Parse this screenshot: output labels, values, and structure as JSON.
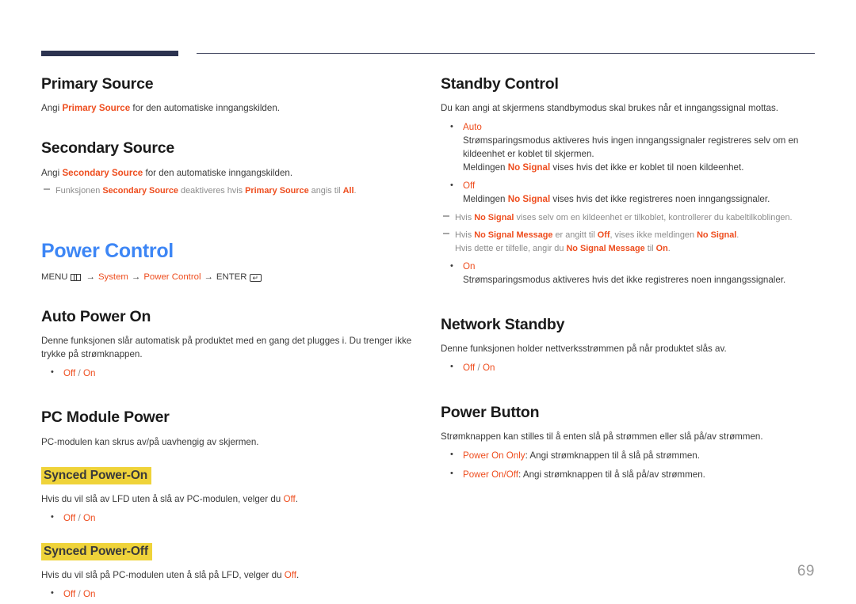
{
  "header": {
    "rule_thick_color": "#2c3350",
    "rule_thin_color": "#4b4f67"
  },
  "colors": {
    "accent": "#ee4d1e",
    "heading_blue": "#3d86f5",
    "highlight_yellow": "#efd33a",
    "muted": "#8c8c8c"
  },
  "left_column": {
    "primary_source": {
      "heading": "Primary Source",
      "para_prefix": "Angi ",
      "para_term": "Primary Source",
      "para_suffix": " for den automatiske inngangskilden."
    },
    "secondary_source": {
      "heading": "Secondary Source",
      "para_prefix": "Angi ",
      "para_term": "Secondary Source",
      "para_suffix": " for den automatiske inngangskilden.",
      "note_a": "Funksjonen ",
      "note_term1": "Secondary Source",
      "note_b": " deaktiveres hvis ",
      "note_term2": "Primary Source",
      "note_c": " angis til ",
      "note_term3": "All",
      "note_d": "."
    },
    "power_control": {
      "heading": "Power Control",
      "menu_label": "MENU",
      "menu_icon": "menu-grid-icon",
      "path_step1": "System",
      "path_step2": "Power Control",
      "enter_label": "ENTER",
      "enter_icon": "enter-key-icon",
      "arrow": "→"
    },
    "auto_power_on": {
      "heading": "Auto Power On",
      "para": "Denne funksjonen slår automatisk på produktet med en gang det plugges i. Du trenger ikke trykke på strømknappen.",
      "option_off": "Off",
      "option_sep": "/",
      "option_on": "On"
    },
    "pc_module_power": {
      "heading": "PC Module Power",
      "para": "PC-modulen kan skrus av/på uavhengig av skjermen.",
      "synced_power_on": {
        "heading": "Synced Power-On",
        "para_prefix": "Hvis du vil slå av LFD uten å slå av PC-modulen, velger du ",
        "para_term": "Off",
        "para_suffix": ".",
        "option_off": "Off",
        "option_sep": "/",
        "option_on": "On"
      },
      "synced_power_off": {
        "heading": "Synced Power-Off",
        "para_prefix": "Hvis du vil slå på PC-modulen uten å slå på LFD, velger du ",
        "para_term": "Off",
        "para_suffix": ".",
        "option_off": "Off",
        "option_sep": "/",
        "option_on": "On"
      }
    }
  },
  "right_column": {
    "standby_control": {
      "heading": "Standby Control",
      "para": "Du kan angi at skjermens standbymodus skal brukes når et inngangssignal mottas.",
      "auto": {
        "label": "Auto",
        "line1": "Strømsparingsmodus aktiveres hvis ingen inngangssignaler registreres selv om en kildeenhet er koblet til skjermen.",
        "line2_prefix": "Meldingen ",
        "line2_term": "No Signal",
        "line2_suffix": " vises hvis det ikke er koblet til noen kildeenhet."
      },
      "off": {
        "label": "Off",
        "line1_prefix": "Meldingen ",
        "line1_term": "No Signal",
        "line1_suffix": " vises hvis det ikke registreres noen inngangssignaler."
      },
      "note1": {
        "a": "Hvis ",
        "term1": "No Signal",
        "b": " vises selv om en kildeenhet er tilkoblet, kontrollerer du kabeltilkoblingen."
      },
      "note2": {
        "a": "Hvis ",
        "term1": "No Signal Message",
        "b": " er angitt til ",
        "term2": "Off",
        "c": ", vises ikke meldingen ",
        "term3": "No Signal",
        "d": ".",
        "cont_a": "Hvis dette er tilfelle, angir du ",
        "cont_term": "No Signal Message",
        "cont_b": " til ",
        "cont_term2": "On",
        "cont_c": "."
      },
      "on": {
        "label": "On",
        "line1": "Strømsparingsmodus aktiveres hvis det ikke registreres noen inngangssignaler."
      }
    },
    "network_standby": {
      "heading": "Network Standby",
      "para": "Denne funksjonen holder nettverksstrømmen på når produktet slås av.",
      "option_off": "Off",
      "option_sep": "/",
      "option_on": "On"
    },
    "power_button": {
      "heading": "Power Button",
      "para": "Strømknappen kan stilles til å enten slå på strømmen eller slå på/av strømmen.",
      "item1_term": "Power On Only",
      "item1_rest": ": Angi strømknappen til å slå på strømmen.",
      "item2_term": "Power On/Off",
      "item2_rest": ": Angi strømknappen til å slå på/av strømmen."
    }
  },
  "footer": {
    "page_number": "69"
  }
}
